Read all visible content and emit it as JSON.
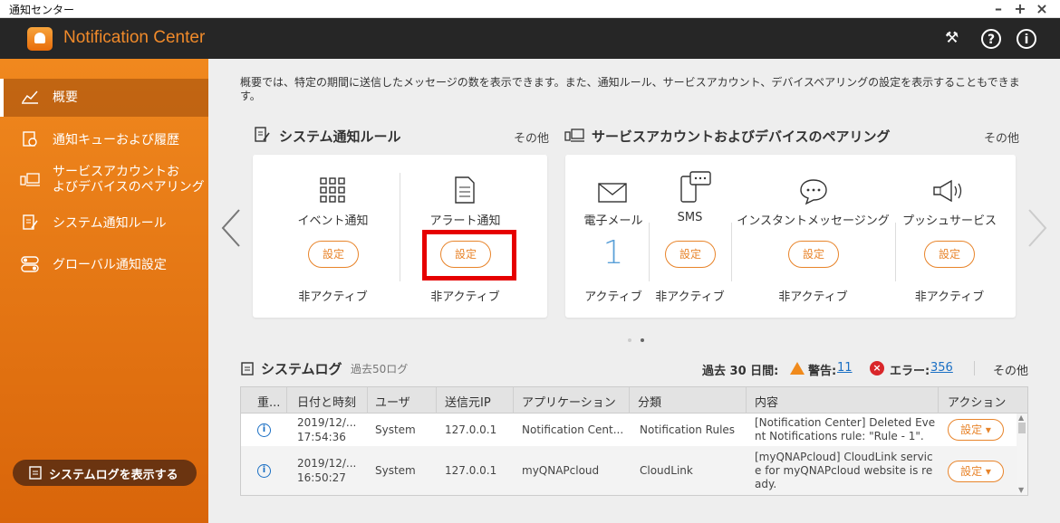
{
  "os": {
    "title": "通知センター",
    "controls": [
      "–",
      "+",
      "×"
    ]
  },
  "header": {
    "title": "Notification Center"
  },
  "sidebar": {
    "items": [
      {
        "label": "概要",
        "icon": "chart-icon"
      },
      {
        "label": "通知キューおよび履歴",
        "icon": "history-icon"
      },
      {
        "label": "サービスアカウントおよびデバイスのペアリング",
        "label_line1": "サービスアカウントお",
        "label_line2": "よびデバイスのペアリング",
        "icon": "device-pairing-icon"
      },
      {
        "label": "システム通知ルール",
        "icon": "rule-edit-icon"
      },
      {
        "label": "グローバル通知設定",
        "icon": "toggle-settings-icon"
      }
    ],
    "syslog_button": "システムログを表示する"
  },
  "main": {
    "intro": "概要では、特定の期間に送信したメッセージの数を表示できます。また、通知ルール、サービスアカウント、デバイスペアリングの設定を表示することもできます。",
    "rules": {
      "title": "システム通知ルール",
      "more": "その他",
      "tiles": [
        {
          "label": "イベント通知",
          "button": "設定",
          "status": "非アクティブ",
          "icon": "grid-icon"
        },
        {
          "label": "アラート通知",
          "button": "設定",
          "status": "非アクティブ",
          "icon": "document-icon"
        }
      ]
    },
    "pairing": {
      "title": "サービスアカウントおよびデバイスのペアリング",
      "more": "その他",
      "tiles": [
        {
          "label": "電子メール",
          "count": "1",
          "status": "アクティブ",
          "icon": "mail-icon"
        },
        {
          "label": "SMS",
          "button": "設定",
          "status": "非アクティブ",
          "icon": "sms-phone-icon"
        },
        {
          "label": "インスタントメッセージング",
          "button": "設定",
          "status": "非アクティブ",
          "icon": "chat-icon"
        },
        {
          "label": "プッシュサービス",
          "button": "設定",
          "status": "非アクティブ",
          "icon": "megaphone-icon"
        }
      ]
    },
    "syslog": {
      "title": "システムログ",
      "subtitle": "過去50ログ",
      "period": "過去 30 日間:",
      "warning_label": "警告:",
      "warning_count": "11",
      "error_label": "エラー:",
      "error_count": "356",
      "more": "その他",
      "columns": [
        "重...",
        "日付と時刻",
        "ユーザ",
        "送信元IP",
        "アプリケーション",
        "分類",
        "内容",
        "アクション"
      ],
      "rows": [
        {
          "date": "2019/12/...",
          "time": "17:54:36",
          "user": "System",
          "ip": "127.0.0.1",
          "app": "Notification Cent...",
          "category": "Notification Rules",
          "content1": "[Notification Center] Deleted Eve",
          "content2": "nt Notifications rule: \"Rule - 1\".",
          "content3": "",
          "action": "設定 ▾"
        },
        {
          "date": "2019/12/...",
          "time": "16:50:27",
          "user": "System",
          "ip": "127.0.0.1",
          "app": "myQNAPcloud",
          "category": "CloudLink",
          "content1": "[myQNAPcloud] CloudLink servic",
          "content2": "e for myQNAPcloud website is re",
          "content3": "ady.",
          "action": "設定 ▾"
        }
      ]
    }
  },
  "colors": {
    "accent": "#f08a2a",
    "sidebar": "#e8780f",
    "highlight": "#e60000",
    "link": "#1a6fc4"
  }
}
